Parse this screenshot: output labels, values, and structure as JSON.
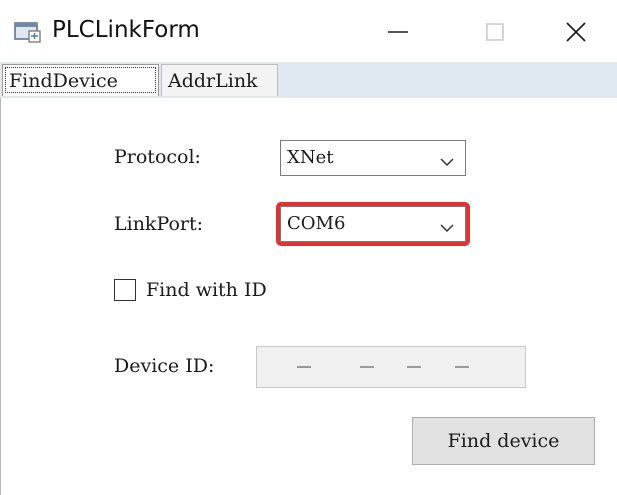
{
  "window": {
    "title": "PLCLinkForm"
  },
  "tabs": [
    {
      "label": "FindDevice",
      "active": true
    },
    {
      "label": "AddrLink",
      "active": false
    }
  ],
  "form": {
    "protocol": {
      "label": "Protocol:",
      "value": "XNet"
    },
    "link_port": {
      "label": "LinkPort:",
      "value": "COM6"
    },
    "find_with_id": {
      "label": "Find with ID",
      "checked": false
    },
    "device_id": {
      "label": "Device ID:",
      "segments": [
        "-",
        "-",
        "-",
        "-"
      ],
      "enabled": false
    },
    "find_button": {
      "label": "Find device"
    }
  },
  "colors": {
    "tabstrip_bg": "#dfe7f1",
    "highlight": "#e03232",
    "button_bg": "#e1e1e1"
  }
}
